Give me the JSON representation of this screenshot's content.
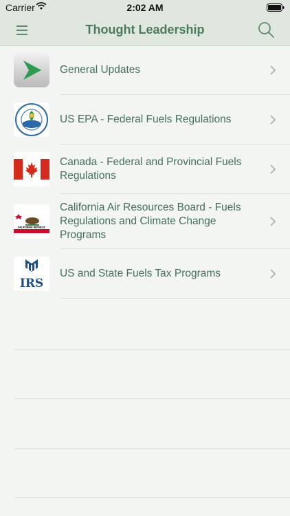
{
  "status_bar": {
    "carrier": "Carrier",
    "time": "2:02 AM",
    "wifi_icon": "wifi-icon",
    "battery_icon": "battery-icon"
  },
  "nav": {
    "title": "Thought Leadership",
    "menu_icon": "hamburger-menu-icon",
    "search_icon": "search-icon"
  },
  "colors": {
    "nav_background": "#dfe7df",
    "text_green": "#44705a",
    "page_background": "#f3f5f3"
  },
  "items": [
    {
      "label": "General Updates",
      "icon": "green-arrow-logo-icon"
    },
    {
      "label": "US EPA - Federal Fuels Regulations",
      "icon": "epa-seal-icon"
    },
    {
      "label": "Canada - Federal and Provincial Fuels Regulations",
      "icon": "canada-flag-icon"
    },
    {
      "label": "California Air Resources Board - Fuels Regulations and Climate Change Programs",
      "icon": "california-flag-icon"
    },
    {
      "label": "US and State Fuels Tax Programs",
      "icon": "irs-logo-icon"
    }
  ],
  "flag_text": {
    "california": "CALIFORNIA REPUBLIC",
    "irs": "IRS"
  }
}
